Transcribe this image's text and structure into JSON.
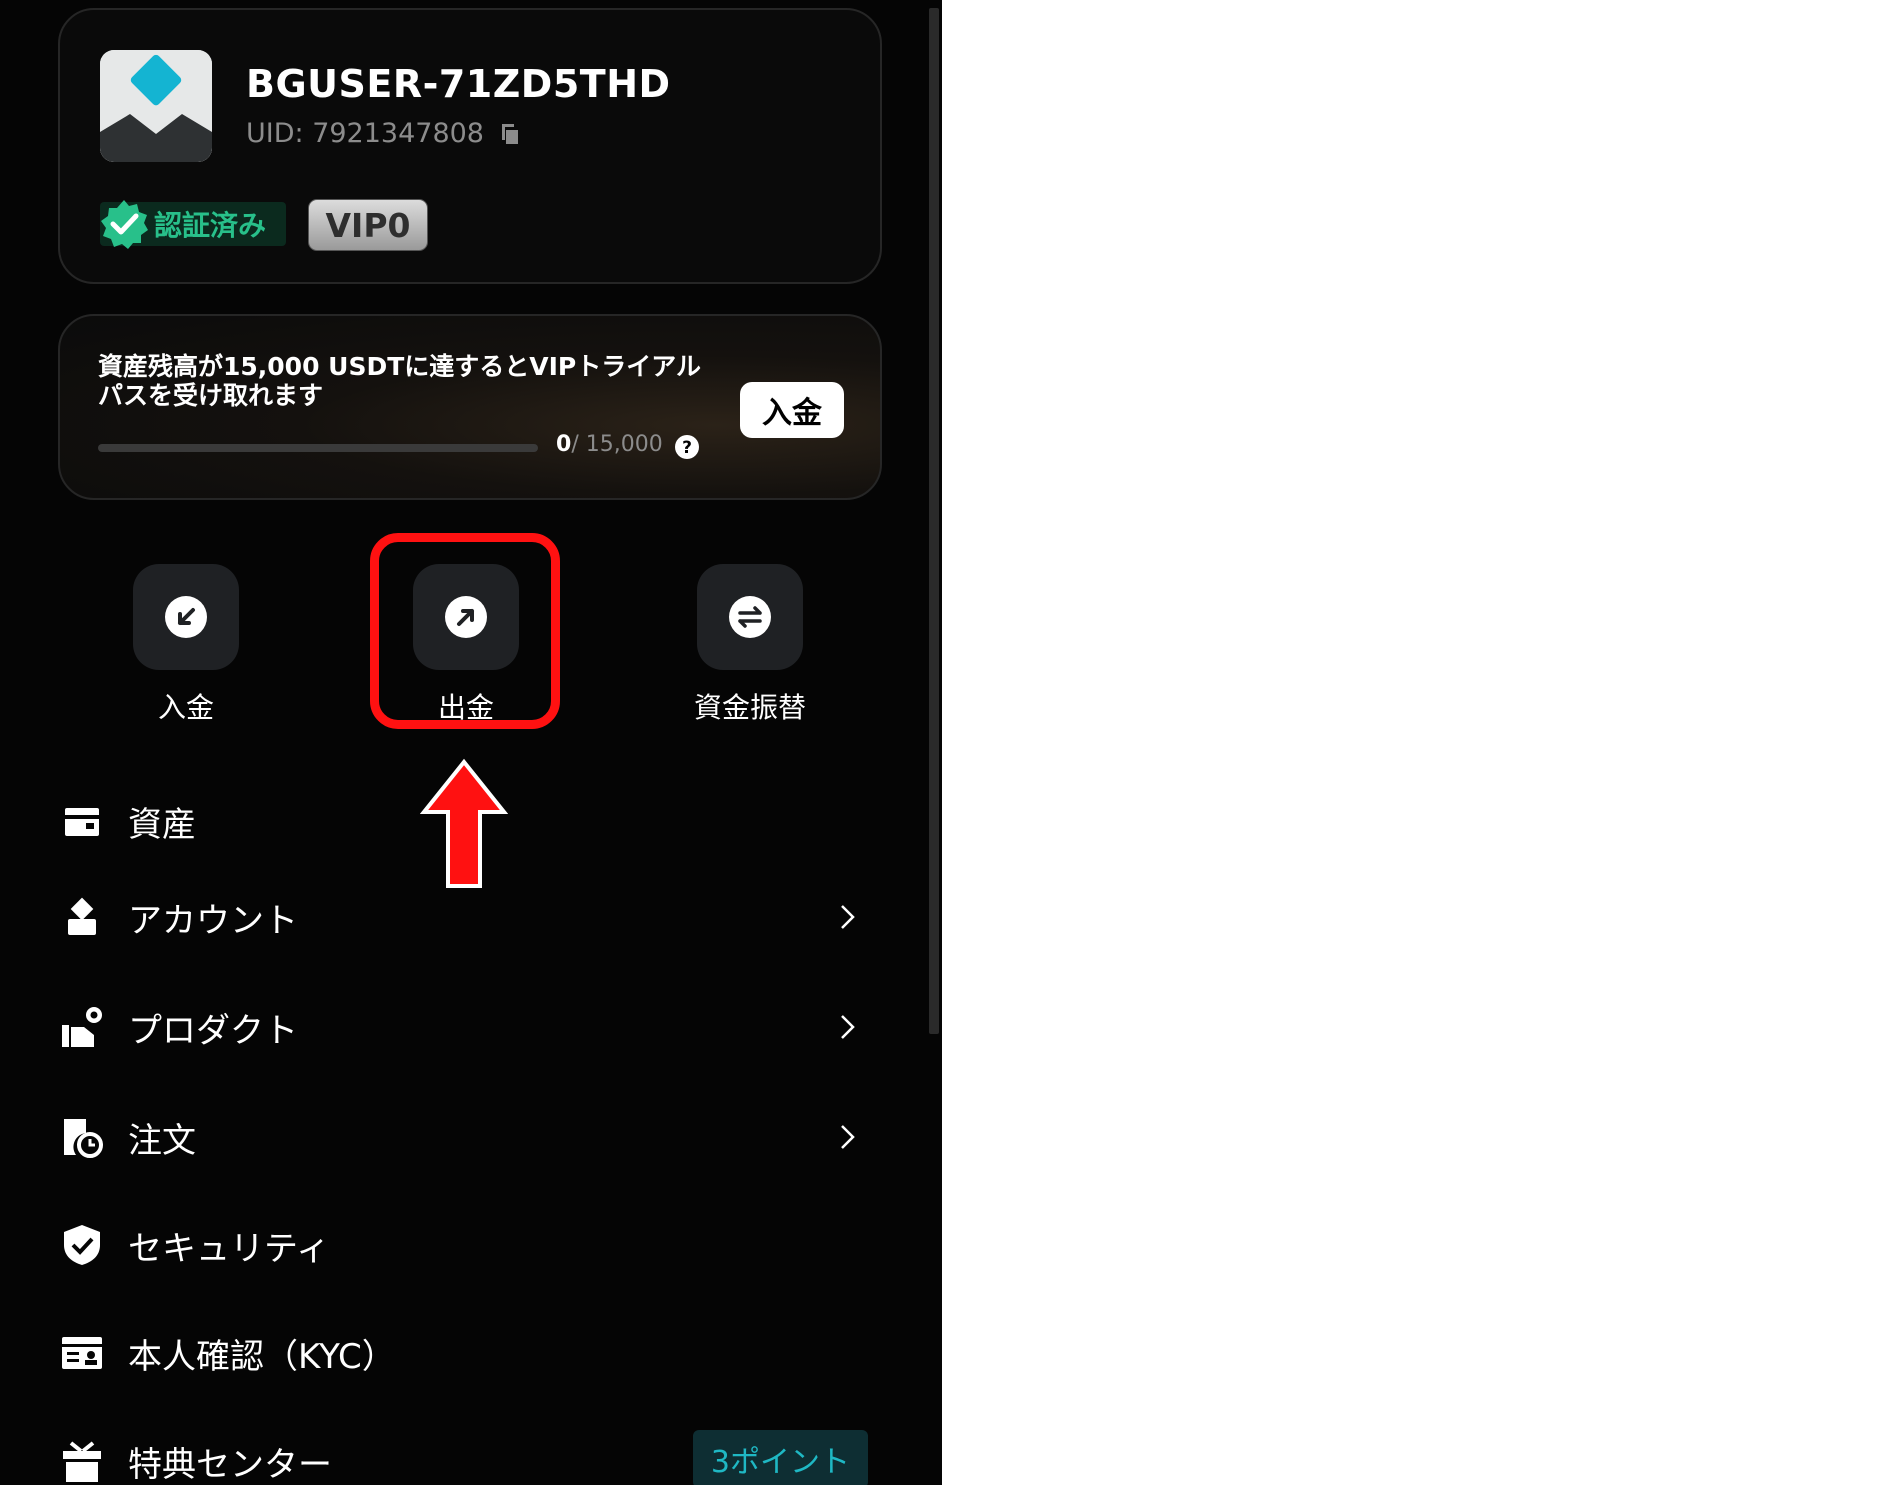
{
  "profile": {
    "username": "BGUSER-71ZD5THD",
    "uid": "UID: 7921347808",
    "verified_label": "認証済み",
    "vip_label": "VIP0"
  },
  "vip_trial": {
    "message": "資産残高が15,000 USDTに達するとVIPトライアルパスを受け取れます",
    "progress_current": "0",
    "progress_total": "/ 15,000",
    "progress_fraction": 0,
    "deposit_button": "入金"
  },
  "actions": [
    {
      "label": "入金",
      "icon": "deposit-icon"
    },
    {
      "label": "出金",
      "icon": "withdraw-icon"
    },
    {
      "label": "資金振替",
      "icon": "transfer-icon"
    }
  ],
  "menu": [
    {
      "label": "資産",
      "icon": "wallet-icon",
      "chevron": false
    },
    {
      "label": "アカウント",
      "icon": "user-icon",
      "chevron": true
    },
    {
      "label": "プロダクト",
      "icon": "product-icon",
      "chevron": true
    },
    {
      "label": "注文",
      "icon": "order-icon",
      "chevron": true
    },
    {
      "label": "セキュリティ",
      "icon": "shield-icon",
      "chevron": false
    },
    {
      "label": "本人確認（KYC）",
      "icon": "id-card-icon",
      "chevron": false
    },
    {
      "label": "特典センター",
      "icon": "gift-icon",
      "chevron": false,
      "badge": "3ポイント"
    }
  ],
  "colors": {
    "background": "#050505",
    "accent_green": "#28c08a",
    "annotation_red": "#ff1111",
    "badge_cyan": "#1fb8c4"
  }
}
